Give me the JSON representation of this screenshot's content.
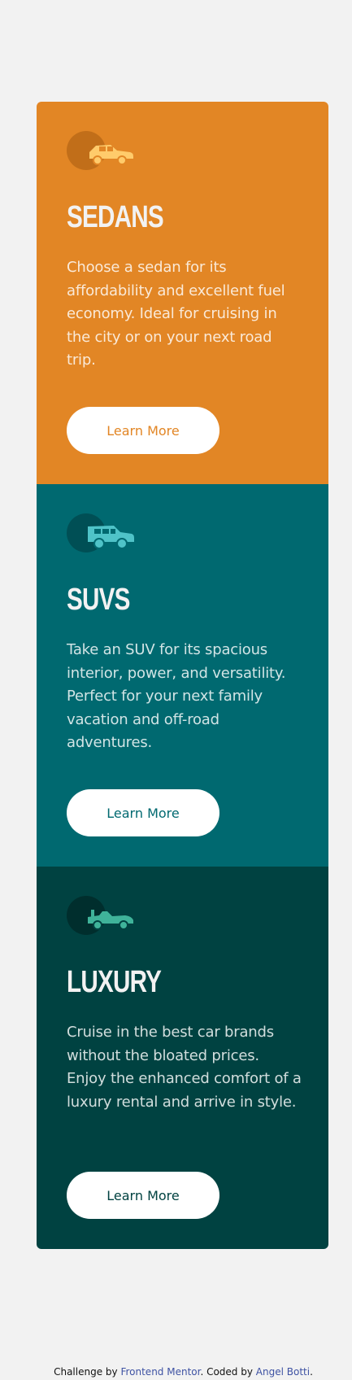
{
  "colors": {
    "page_bg": "#f2f2f2",
    "sedans": "#e28625",
    "suvs": "#006970",
    "luxury": "#004241",
    "button_bg": "#ffffff"
  },
  "cards": [
    {
      "title": "Sedans",
      "text": "Choose a sedan for its affordability and excellent fuel economy. Ideal for cruising in the city or on your next road trip.",
      "button": "Learn More",
      "icon": "sedan-car-icon"
    },
    {
      "title": "SUVs",
      "text": "Take an SUV for its spacious interior, power, and versatility. Perfect for your next family vacation and off-road adventures.",
      "button": "Learn More",
      "icon": "suv-car-icon"
    },
    {
      "title": "Luxury",
      "text": "Cruise in the best car brands without the bloated prices. Enjoy the enhanced comfort of a luxury rental and arrive in style.",
      "button": "Learn More",
      "icon": "luxury-car-icon"
    }
  ],
  "footer": {
    "prefix": "Challenge by",
    "mentor": "Frontend Mentor",
    "middle": ". Coded by",
    "author": "Angel Botti",
    "suffix": "."
  }
}
